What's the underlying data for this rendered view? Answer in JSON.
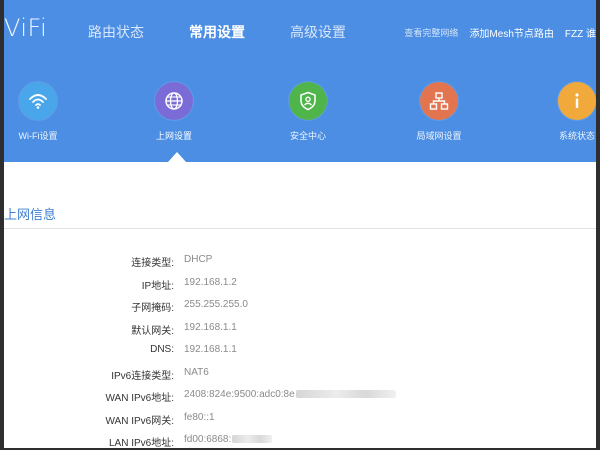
{
  "logo": "ViFi",
  "nav": {
    "tabs": [
      "路由状态",
      "常用设置",
      "高级设置"
    ],
    "active": 1
  },
  "toplinks": [
    "查看完整网络",
    "添加Mesh节点路由",
    "FZZ 谁"
  ],
  "icons": [
    {
      "name": "wifi-icon",
      "label": "Wi-Fi设置",
      "color": "#4aa6ea"
    },
    {
      "name": "globe-icon",
      "label": "上网设置",
      "color": "#7b6bd6"
    },
    {
      "name": "shield-icon",
      "label": "安全中心",
      "color": "#4fb54a"
    },
    {
      "name": "network-icon",
      "label": "局域网设置",
      "color": "#e27550"
    },
    {
      "name": "info-icon",
      "label": "系统状态",
      "color": "#f2a93b"
    }
  ],
  "section": {
    "title": "上网信息"
  },
  "info_rows": [
    {
      "label": "连接类型:",
      "value": "DHCP"
    },
    {
      "label": "IP地址:",
      "value": "192.168.1.2"
    },
    {
      "label": "子网掩码:",
      "value": "255.255.255.0"
    },
    {
      "label": "默认网关:",
      "value": "192.168.1.1"
    },
    {
      "label": "DNS:",
      "value": "192.168.1.1"
    },
    {
      "label": "IPv6连接类型:",
      "value": "NAT6"
    },
    {
      "label": "WAN IPv6地址:",
      "value": "2408:824e:9500:adc0:8e"
    },
    {
      "label": "WAN IPv6网关:",
      "value": "fe80::1"
    },
    {
      "label": "LAN IPv6地址:",
      "value": "fd00:6868:"
    }
  ],
  "colors": {
    "header": "#4b8ee3",
    "accent": "#3f7fcf"
  }
}
